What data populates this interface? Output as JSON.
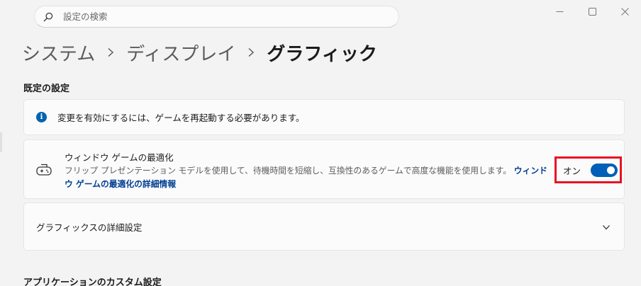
{
  "search": {
    "placeholder": "設定の検索"
  },
  "breadcrumb": {
    "items": [
      "システム",
      "ディスプレイ",
      "グラフィック"
    ]
  },
  "sections": {
    "default_settings_title": "既定の設定",
    "app_custom_title": "アプリケーションのカスタム設定"
  },
  "info": {
    "text": "変更を有効にするには、ゲームを再起動する必要があります。"
  },
  "window_game_opt": {
    "title": "ウィンドウ ゲームの最適化",
    "description": "フリップ プレゼンテーション モデルを使用して、待機時間を短縮し、互換性のあるゲームで高度な機能を使用します。",
    "link": "ウィンドウ ゲームの最適化の詳細情報",
    "toggle_label": "オン",
    "toggle_state": "on"
  },
  "advanced": {
    "label": "グラフィックスの詳細設定"
  },
  "colors": {
    "accent": "#005fb8",
    "highlight": "#e81123"
  },
  "icons": {
    "search": "search-icon",
    "minimize": "minimize-icon",
    "maximize": "maximize-icon",
    "close": "close-icon",
    "info": "info-icon",
    "gamepad": "gamepad-icon",
    "chevron": "chevron-down-icon"
  }
}
